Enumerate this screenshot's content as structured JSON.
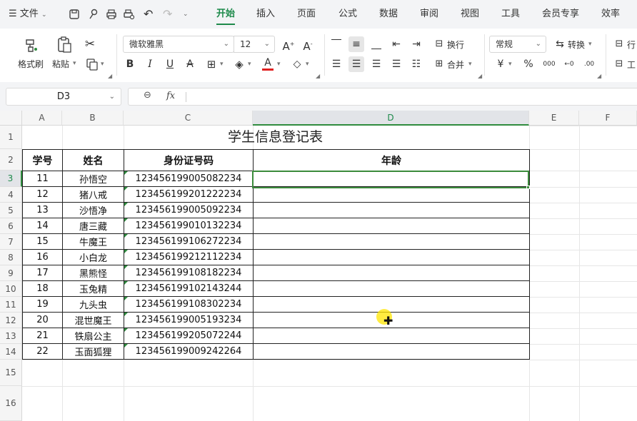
{
  "menubar": {
    "file_label": "文件",
    "tabs": [
      "开始",
      "插入",
      "页面",
      "公式",
      "数据",
      "审阅",
      "视图",
      "工具",
      "会员专享",
      "效率"
    ],
    "active_tab": "开始"
  },
  "ribbon": {
    "format_painter": "格式刷",
    "paste": "粘贴",
    "font_name": "微软雅黑",
    "font_size": "12",
    "wrap": "换行",
    "merge": "合并",
    "number_format": "常规",
    "convert": "转换",
    "row_col_partial": "行",
    "worksheet_partial": "工"
  },
  "formula_bar": {
    "name_box": "D3",
    "fx": "fx",
    "formula": ""
  },
  "sheet": {
    "columns": [
      "A",
      "B",
      "C",
      "D",
      "E",
      "F"
    ],
    "selected_column": "D",
    "rows": [
      "1",
      "2",
      "3",
      "4",
      "5",
      "6",
      "7",
      "8",
      "9",
      "10",
      "11",
      "12",
      "13",
      "14",
      "15",
      "16"
    ],
    "selected_row": "3",
    "title": "学生信息登记表",
    "headers": [
      "学号",
      "姓名",
      "身份证号码",
      "年龄"
    ],
    "records": [
      {
        "id": "11",
        "name": "孙悟空",
        "idcard": "123456199005082234",
        "age": ""
      },
      {
        "id": "12",
        "name": "猪八戒",
        "idcard": "123456199201222234",
        "age": ""
      },
      {
        "id": "13",
        "name": "沙悟净",
        "idcard": "123456199005092234",
        "age": ""
      },
      {
        "id": "14",
        "name": "唐三藏",
        "idcard": "123456199010132234",
        "age": ""
      },
      {
        "id": "15",
        "name": "牛魔王",
        "idcard": "123456199106272234",
        "age": ""
      },
      {
        "id": "16",
        "name": "小白龙",
        "idcard": "123456199212112234",
        "age": ""
      },
      {
        "id": "17",
        "name": "黑熊怪",
        "idcard": "123456199108182234",
        "age": ""
      },
      {
        "id": "18",
        "name": "玉兔精",
        "idcard": "123456199102143244",
        "age": ""
      },
      {
        "id": "19",
        "name": "九头虫",
        "idcard": "123456199108302234",
        "age": ""
      },
      {
        "id": "20",
        "name": "混世魔王",
        "idcard": "123456199005193234",
        "age": ""
      },
      {
        "id": "21",
        "name": "铁扇公主",
        "idcard": "123456199205072244",
        "age": ""
      },
      {
        "id": "22",
        "name": "玉面狐狸",
        "idcard": "123456199009242264",
        "age": ""
      }
    ]
  },
  "colors": {
    "accent": "#1e8a4b",
    "selection": "#3b8b3b",
    "font_color_bar": "#e02020"
  }
}
